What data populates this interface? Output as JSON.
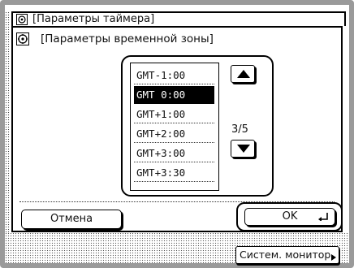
{
  "background_window": {
    "title": "[Параметры таймера]",
    "icon": "settings-gear-icon"
  },
  "dialog": {
    "title": "[Параметры временной зоны]",
    "icon": "settings-gear-icon"
  },
  "timezone_list": {
    "items": [
      {
        "label": "GMT-1:00",
        "selected": false
      },
      {
        "label": "GMT 0:00",
        "selected": true
      },
      {
        "label": "GMT+1:00",
        "selected": false
      },
      {
        "label": "GMT+2:00",
        "selected": false
      },
      {
        "label": "GMT+3:00",
        "selected": false
      },
      {
        "label": "GMT+3:30",
        "selected": false
      }
    ],
    "page_indicator": "3/5",
    "scroll_up_icon": "triangle-up-icon",
    "scroll_down_icon": "triangle-down-icon"
  },
  "buttons": {
    "cancel_label": "Отмена",
    "ok_label": "OK",
    "ok_icon": "enter-return-icon"
  },
  "footer": {
    "status_monitor_label": "Систем. монитор",
    "status_monitor_icon": "small-arrow-icon"
  },
  "colors": {
    "selection_background": "#000000",
    "selection_text": "#ffffff",
    "bezel": "#9a9a9a"
  }
}
